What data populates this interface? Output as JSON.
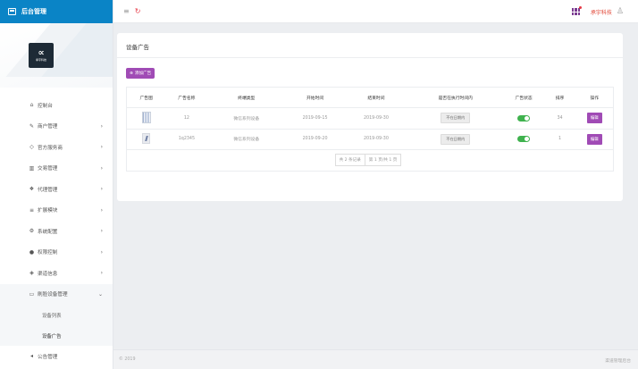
{
  "app": {
    "title": "后台管理"
  },
  "logo": {
    "mark": "C",
    "text": "承宇科技"
  },
  "topbar": {
    "company": "承宇科技",
    "menu_icon": "hamburger-icon",
    "refresh_icon": "refresh-icon",
    "user_icon": "user-icon"
  },
  "sidebar": {
    "items": [
      {
        "label": "控制台",
        "icon": "home-icon",
        "glyph": "⌂",
        "arrow": ""
      },
      {
        "label": "商户管理",
        "icon": "pencil-icon",
        "glyph": "✎",
        "arrow": "›"
      },
      {
        "label": "官方服务商",
        "icon": "diamond-icon",
        "glyph": "◇",
        "arrow": "›"
      },
      {
        "label": "交易管理",
        "icon": "chart-icon",
        "glyph": "▥",
        "arrow": "›"
      },
      {
        "label": "代理管理",
        "icon": "agent-icon",
        "glyph": "❖",
        "arrow": "›"
      },
      {
        "label": "扩展模块",
        "icon": "list-icon",
        "glyph": "≡",
        "arrow": "›"
      },
      {
        "label": "系统配置",
        "icon": "gear-icon",
        "glyph": "⚙",
        "arrow": "›"
      },
      {
        "label": "权限控制",
        "icon": "shield-icon",
        "glyph": "●",
        "arrow": "›"
      },
      {
        "label": "渠道信息",
        "icon": "channel-icon",
        "glyph": "◈",
        "arrow": "›"
      },
      {
        "label": "刷脸设备管理",
        "icon": "monitor-icon",
        "glyph": "▭",
        "arrow": "⌄"
      }
    ],
    "sub_items": [
      {
        "label": "设备列表"
      },
      {
        "label": "设备广告"
      }
    ],
    "last_item": {
      "label": "公告管理",
      "icon": "megaphone-icon",
      "glyph": "◂"
    }
  },
  "page": {
    "title": "设备广告",
    "add_button": "添加广告",
    "columns": [
      "广告图",
      "广告名称",
      "终端类型",
      "开始时间",
      "结束时间",
      "是否在执行时间内",
      "广告状态",
      "排序",
      "操作"
    ],
    "rows": [
      {
        "name": "12",
        "terminal": "微信系列设备",
        "start": "2019-09-15",
        "end": "2019-09-30",
        "in_time": "不在日期内",
        "status_on": true,
        "sort": "34",
        "action": "编辑"
      },
      {
        "name": "1q2345",
        "terminal": "微信系列设备",
        "start": "2019-09-20",
        "end": "2019-09-30",
        "in_time": "不在日期内",
        "status_on": true,
        "sort": "1",
        "action": "编辑"
      }
    ],
    "pager": {
      "total": "共 2 条记录",
      "page": "第 1 页/共 1 页"
    }
  },
  "footer": {
    "copyright": "© 2019",
    "right": "渠道管理后台"
  },
  "colors": {
    "brand": "#0a84c6",
    "accent": "#a04bb5",
    "toggle_on": "#3fb24e",
    "company": "#e24a3a"
  }
}
